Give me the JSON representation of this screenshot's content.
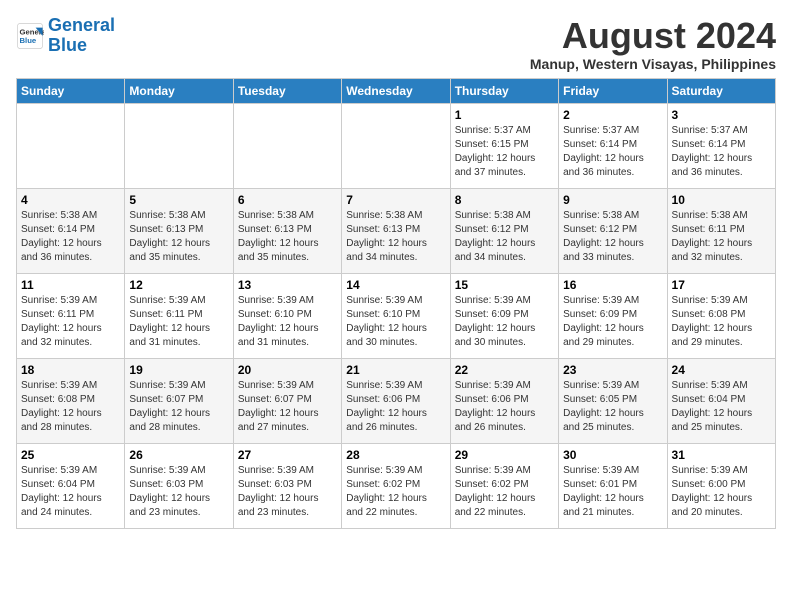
{
  "header": {
    "logo_line1": "General",
    "logo_line2": "Blue",
    "month_title": "August 2024",
    "location": "Manup, Western Visayas, Philippines"
  },
  "weekdays": [
    "Sunday",
    "Monday",
    "Tuesday",
    "Wednesday",
    "Thursday",
    "Friday",
    "Saturday"
  ],
  "weeks": [
    [
      {
        "day": "",
        "content": ""
      },
      {
        "day": "",
        "content": ""
      },
      {
        "day": "",
        "content": ""
      },
      {
        "day": "",
        "content": ""
      },
      {
        "day": "1",
        "content": "Sunrise: 5:37 AM\nSunset: 6:15 PM\nDaylight: 12 hours\nand 37 minutes."
      },
      {
        "day": "2",
        "content": "Sunrise: 5:37 AM\nSunset: 6:14 PM\nDaylight: 12 hours\nand 36 minutes."
      },
      {
        "day": "3",
        "content": "Sunrise: 5:37 AM\nSunset: 6:14 PM\nDaylight: 12 hours\nand 36 minutes."
      }
    ],
    [
      {
        "day": "4",
        "content": "Sunrise: 5:38 AM\nSunset: 6:14 PM\nDaylight: 12 hours\nand 36 minutes."
      },
      {
        "day": "5",
        "content": "Sunrise: 5:38 AM\nSunset: 6:13 PM\nDaylight: 12 hours\nand 35 minutes."
      },
      {
        "day": "6",
        "content": "Sunrise: 5:38 AM\nSunset: 6:13 PM\nDaylight: 12 hours\nand 35 minutes."
      },
      {
        "day": "7",
        "content": "Sunrise: 5:38 AM\nSunset: 6:13 PM\nDaylight: 12 hours\nand 34 minutes."
      },
      {
        "day": "8",
        "content": "Sunrise: 5:38 AM\nSunset: 6:12 PM\nDaylight: 12 hours\nand 34 minutes."
      },
      {
        "day": "9",
        "content": "Sunrise: 5:38 AM\nSunset: 6:12 PM\nDaylight: 12 hours\nand 33 minutes."
      },
      {
        "day": "10",
        "content": "Sunrise: 5:38 AM\nSunset: 6:11 PM\nDaylight: 12 hours\nand 32 minutes."
      }
    ],
    [
      {
        "day": "11",
        "content": "Sunrise: 5:39 AM\nSunset: 6:11 PM\nDaylight: 12 hours\nand 32 minutes."
      },
      {
        "day": "12",
        "content": "Sunrise: 5:39 AM\nSunset: 6:11 PM\nDaylight: 12 hours\nand 31 minutes."
      },
      {
        "day": "13",
        "content": "Sunrise: 5:39 AM\nSunset: 6:10 PM\nDaylight: 12 hours\nand 31 minutes."
      },
      {
        "day": "14",
        "content": "Sunrise: 5:39 AM\nSunset: 6:10 PM\nDaylight: 12 hours\nand 30 minutes."
      },
      {
        "day": "15",
        "content": "Sunrise: 5:39 AM\nSunset: 6:09 PM\nDaylight: 12 hours\nand 30 minutes."
      },
      {
        "day": "16",
        "content": "Sunrise: 5:39 AM\nSunset: 6:09 PM\nDaylight: 12 hours\nand 29 minutes."
      },
      {
        "day": "17",
        "content": "Sunrise: 5:39 AM\nSunset: 6:08 PM\nDaylight: 12 hours\nand 29 minutes."
      }
    ],
    [
      {
        "day": "18",
        "content": "Sunrise: 5:39 AM\nSunset: 6:08 PM\nDaylight: 12 hours\nand 28 minutes."
      },
      {
        "day": "19",
        "content": "Sunrise: 5:39 AM\nSunset: 6:07 PM\nDaylight: 12 hours\nand 28 minutes."
      },
      {
        "day": "20",
        "content": "Sunrise: 5:39 AM\nSunset: 6:07 PM\nDaylight: 12 hours\nand 27 minutes."
      },
      {
        "day": "21",
        "content": "Sunrise: 5:39 AM\nSunset: 6:06 PM\nDaylight: 12 hours\nand 26 minutes."
      },
      {
        "day": "22",
        "content": "Sunrise: 5:39 AM\nSunset: 6:06 PM\nDaylight: 12 hours\nand 26 minutes."
      },
      {
        "day": "23",
        "content": "Sunrise: 5:39 AM\nSunset: 6:05 PM\nDaylight: 12 hours\nand 25 minutes."
      },
      {
        "day": "24",
        "content": "Sunrise: 5:39 AM\nSunset: 6:04 PM\nDaylight: 12 hours\nand 25 minutes."
      }
    ],
    [
      {
        "day": "25",
        "content": "Sunrise: 5:39 AM\nSunset: 6:04 PM\nDaylight: 12 hours\nand 24 minutes."
      },
      {
        "day": "26",
        "content": "Sunrise: 5:39 AM\nSunset: 6:03 PM\nDaylight: 12 hours\nand 23 minutes."
      },
      {
        "day": "27",
        "content": "Sunrise: 5:39 AM\nSunset: 6:03 PM\nDaylight: 12 hours\nand 23 minutes."
      },
      {
        "day": "28",
        "content": "Sunrise: 5:39 AM\nSunset: 6:02 PM\nDaylight: 12 hours\nand 22 minutes."
      },
      {
        "day": "29",
        "content": "Sunrise: 5:39 AM\nSunset: 6:02 PM\nDaylight: 12 hours\nand 22 minutes."
      },
      {
        "day": "30",
        "content": "Sunrise: 5:39 AM\nSunset: 6:01 PM\nDaylight: 12 hours\nand 21 minutes."
      },
      {
        "day": "31",
        "content": "Sunrise: 5:39 AM\nSunset: 6:00 PM\nDaylight: 12 hours\nand 20 minutes."
      }
    ]
  ]
}
